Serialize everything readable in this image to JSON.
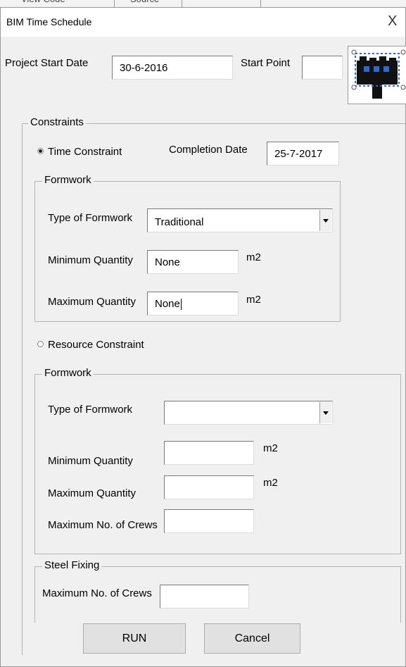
{
  "background_strip": {
    "fragments": [
      "View Code",
      "Source"
    ]
  },
  "dialog": {
    "title": "BIM Time Schedule",
    "close_glyph": "X",
    "project_start_date": {
      "label": "Project Start Date",
      "value": "30-6-2016"
    },
    "start_point": {
      "label": "Start Point",
      "value": ""
    },
    "constraints": {
      "caption": "Constraints",
      "time_constraint": {
        "label": "Time Constraint",
        "selected": true,
        "completion_date": {
          "label": "Completion Date",
          "value": "25-7-2017"
        },
        "formwork": {
          "caption": "Formwork",
          "type_label": "Type of Formwork",
          "type_value": "Traditional",
          "min_label": "Minimum Quantity",
          "min_value": "None",
          "min_unit": "m2",
          "max_label": "Maximum Quantity",
          "max_value": "None",
          "max_unit": "m2"
        }
      },
      "resource_constraint": {
        "label": "Resource Constraint",
        "selected": false,
        "formwork": {
          "caption": "Formwork",
          "type_label": "Type of Formwork",
          "type_value": "",
          "min_label": "Minimum Quantity",
          "min_value": "",
          "min_unit": "m2",
          "max_label": "Maximum Quantity",
          "max_value": "",
          "max_unit": "m2",
          "crews_label": "Maximum No. of Crews",
          "crews_value": ""
        },
        "steel_fixing": {
          "caption": "Steel Fixing",
          "crews_label": "Maximum No. of Crews",
          "crews_value": ""
        }
      }
    },
    "buttons": {
      "run": "RUN",
      "cancel": "Cancel"
    }
  },
  "colors": {
    "dialog_bg": "#f0f0f0",
    "textbox_bg": "#ffffff",
    "button_bg": "#e1e1e1"
  }
}
